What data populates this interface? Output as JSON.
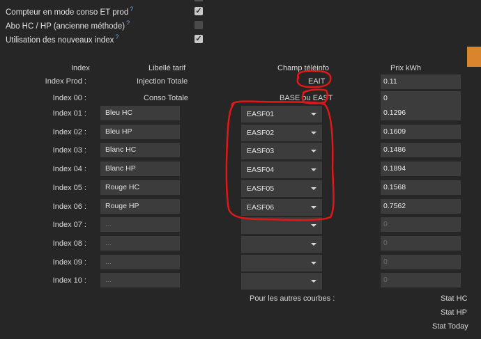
{
  "options": [
    {
      "label": "Compteur en mode conso ET prod",
      "help": "?",
      "checked": true
    },
    {
      "label": "Abo HC / HP (ancienne méthode)",
      "help": "?",
      "checked": false
    },
    {
      "label": "Utilisation des nouveaux index",
      "help": "?",
      "checked": true
    }
  ],
  "checkmark": "✓",
  "headers": {
    "index": "Index",
    "libelle": "Libellé tarif",
    "champ": "Champ téléinfo",
    "prix": "Prix kWh"
  },
  "prod_row": {
    "label": "Index Prod :",
    "libelle": "Injection Totale",
    "champ": "EAIT",
    "prix": "0.11"
  },
  "conso_row": {
    "label": "Index 00 :",
    "libelle": "Conso Totale",
    "champ_prefix": "BASE ou",
    "champ": "EAST",
    "prix": "0"
  },
  "rows": [
    {
      "label": "Index 01 :",
      "libelle": "Bleu HC",
      "champ": "EASF01",
      "prix": "0.1296"
    },
    {
      "label": "Index 02 :",
      "libelle": "Bleu HP",
      "champ": "EASF02",
      "prix": "0.1609"
    },
    {
      "label": "Index 03 :",
      "libelle": "Blanc HC",
      "champ": "EASF03",
      "prix": "0.1486"
    },
    {
      "label": "Index 04 :",
      "libelle": "Blanc HP",
      "champ": "EASF04",
      "prix": "0.1894"
    },
    {
      "label": "Index 05 :",
      "libelle": "Rouge HC",
      "champ": "EASF05",
      "prix": "0.1568"
    },
    {
      "label": "Index 06 :",
      "libelle": "Rouge HP",
      "champ": "EASF06",
      "prix": "0.7562"
    },
    {
      "label": "Index 07 :",
      "libelle": "...",
      "champ": "",
      "prix": "0"
    },
    {
      "label": "Index 08 :",
      "libelle": "...",
      "champ": "",
      "prix": "0"
    },
    {
      "label": "Index 09 :",
      "libelle": "...",
      "champ": "",
      "prix": "0"
    },
    {
      "label": "Index 10 :",
      "libelle": "...",
      "champ": "",
      "prix": "0"
    }
  ],
  "footer": {
    "autres": "Pour les autres courbes :",
    "stat_hc": "Stat HC",
    "stat_hp": "Stat HP",
    "stat_today": "Stat Today"
  },
  "colors": {
    "background": "#262626",
    "field": "#3c3c3c",
    "accent": "#d9852c",
    "annotation": "#e01818",
    "help": "#6fa3d8"
  }
}
